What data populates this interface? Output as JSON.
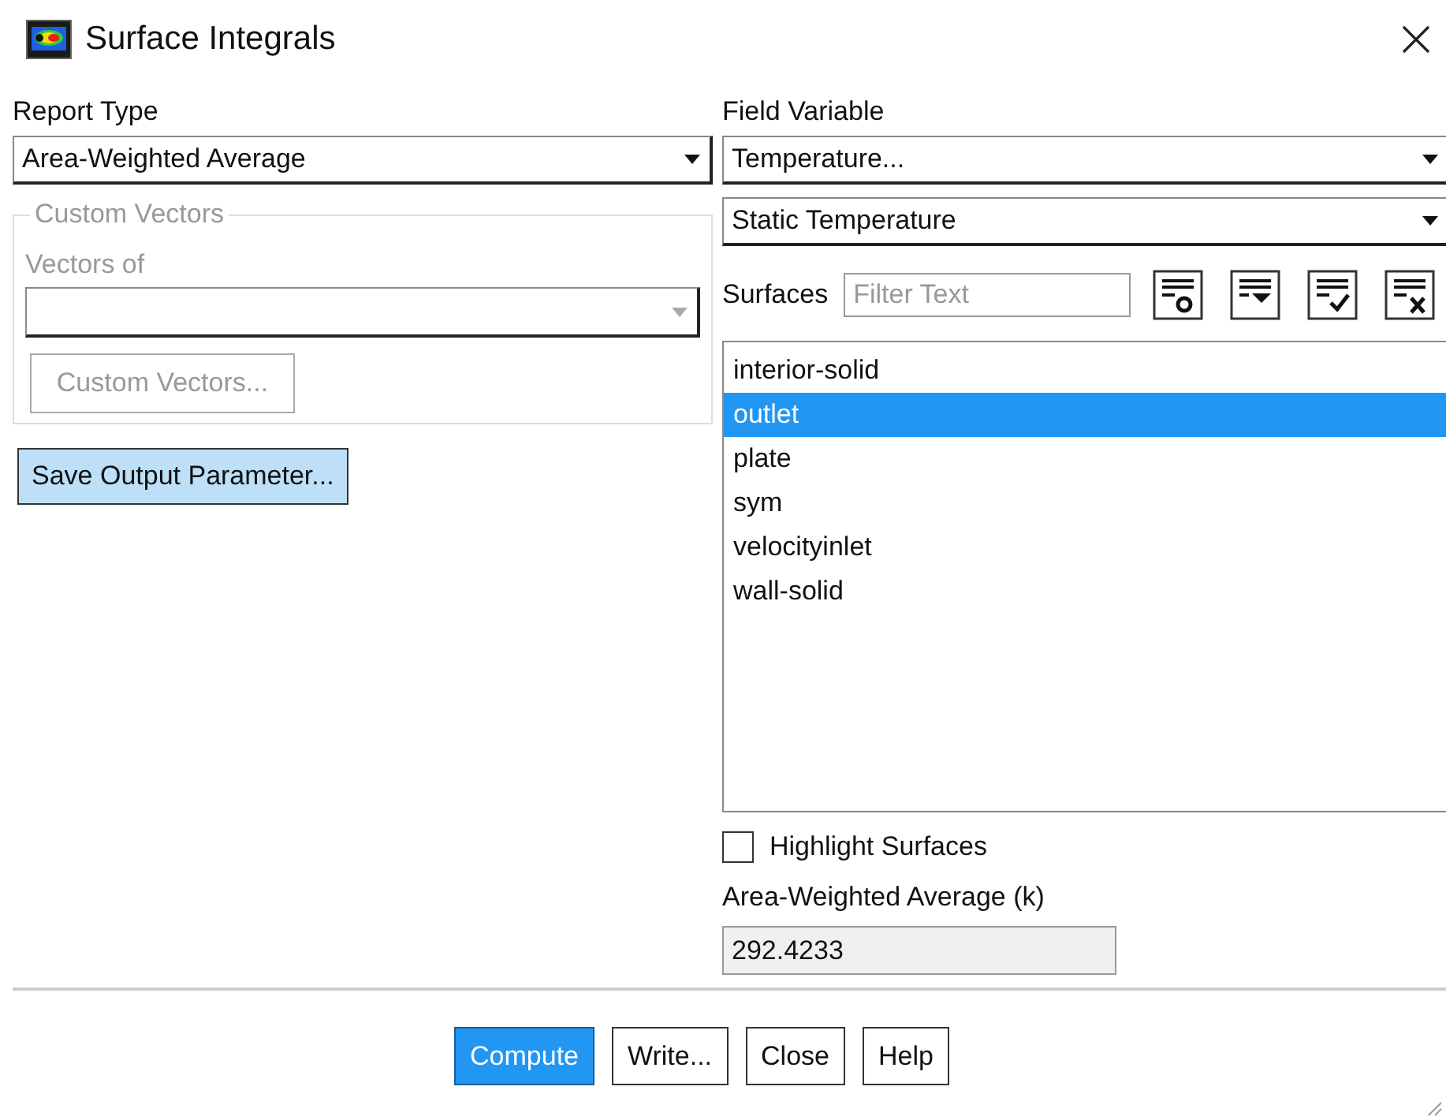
{
  "window": {
    "title": "Surface Integrals"
  },
  "report_type": {
    "label": "Report Type",
    "value": "Area-Weighted Average"
  },
  "custom_vectors": {
    "title": "Custom Vectors",
    "disabled": true,
    "vectors_of_label": "Vectors of",
    "button": "Custom Vectors..."
  },
  "save_button": {
    "label": "Save Output Parameter...",
    "highlighted": true
  },
  "field_variable": {
    "label": "Field Variable",
    "category": "Temperature...",
    "value": "Static Temperature"
  },
  "surfaces": {
    "label": "Surfaces",
    "filter_placeholder": "Filter Text",
    "tools": [
      {
        "kind": "filter"
      },
      {
        "kind": "expand"
      },
      {
        "kind": "select-all"
      },
      {
        "kind": "deselect-all"
      }
    ],
    "items": [
      {
        "label": "interior-solid",
        "selected": false
      },
      {
        "label": "outlet",
        "selected": true
      },
      {
        "label": "plate",
        "selected": false
      },
      {
        "label": "sym",
        "selected": false
      },
      {
        "label": "velocityinlet",
        "selected": false
      },
      {
        "label": "wall-solid",
        "selected": false
      }
    ]
  },
  "highlight_surfaces": {
    "label": "Highlight Surfaces",
    "checked": false
  },
  "result": {
    "label": "Area-Weighted Average (k)",
    "value": "292.4233"
  },
  "buttons": [
    {
      "label": "Compute",
      "primary": true
    },
    {
      "label": "Write...",
      "primary": false
    },
    {
      "label": "Close",
      "primary": false
    },
    {
      "label": "Help",
      "primary": false
    }
  ]
}
